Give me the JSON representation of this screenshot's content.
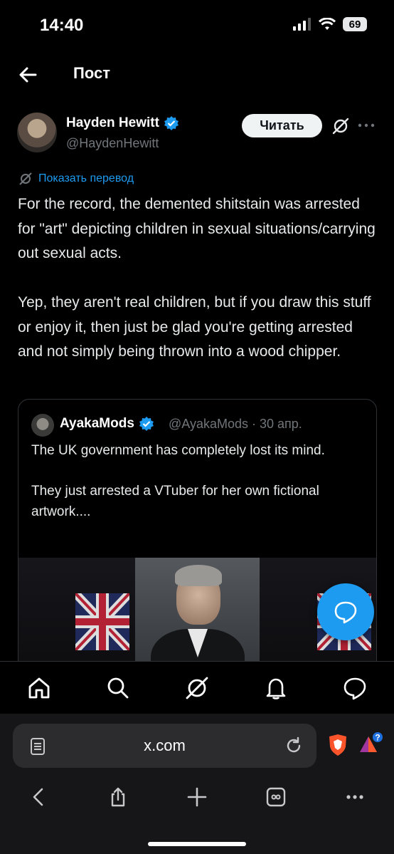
{
  "status_bar": {
    "time": "14:40",
    "battery": "69"
  },
  "header": {
    "title": "Пост"
  },
  "author": {
    "name": "Hayden Hewitt",
    "handle": "@HaydenHewitt",
    "follow_label": "Читать"
  },
  "post": {
    "translate_label": "Показать перевод",
    "text": "For the record, the demented shitstain was arrested for \"art\" depicting children in sexual situations/carrying out sexual acts.\n\nYep, they aren't real children, but if you draw this stuff or enjoy it, then just be glad you're getting arrested and not simply being thrown into a wood chipper."
  },
  "quote": {
    "name": "AyakaMods",
    "handle_date": "@AyakaMods · 30 апр.",
    "text": "The UK government has completely lost its mind.\n\nThey just arrested a VTuber for her own fictional artwork...."
  },
  "tabbar": {
    "items": [
      "home-icon",
      "search-icon",
      "grok-icon",
      "notifications-icon",
      "messages-icon"
    ]
  },
  "browser": {
    "url": "x.com",
    "rewards_badge": "?"
  },
  "colors": {
    "accent": "#1d9bf0",
    "background": "#000000",
    "muted": "#71767b"
  }
}
